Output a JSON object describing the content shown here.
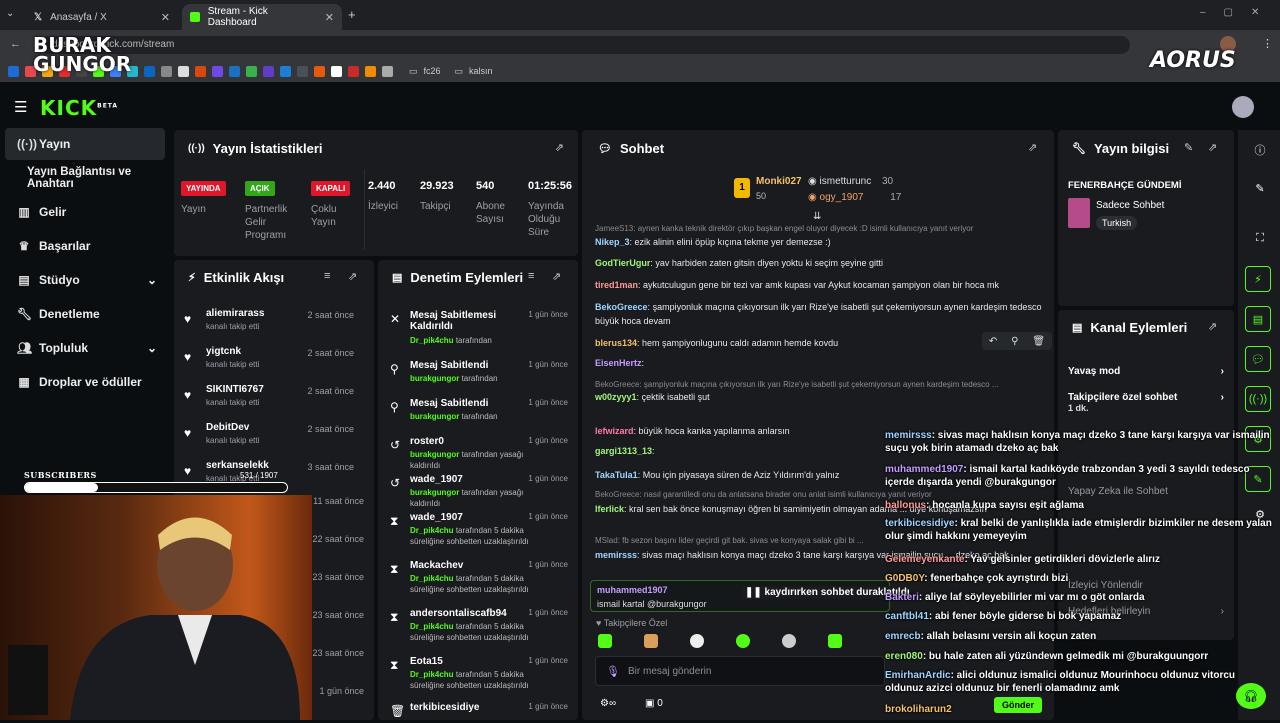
{
  "browser": {
    "tabs": [
      {
        "label": "Anasayfa / X"
      },
      {
        "label": "Stream - Kick Dashboard"
      }
    ],
    "url": "dashboard.kick.com/stream",
    "bookmarks": [
      "fc26",
      "kalsın"
    ]
  },
  "watermark": {
    "line1": "BURAK",
    "line2": "GUNGOR",
    "brand": "AORUS"
  },
  "kick": {
    "logo": "KICK",
    "beta": "BETA"
  },
  "sidebar": {
    "items": [
      {
        "label": "Yayın",
        "icon": "broadcast-icon"
      },
      {
        "label": "Yayın Bağlantısı ve Anahtarı",
        "icon": ""
      },
      {
        "label": "Gelir",
        "icon": "chart-icon"
      },
      {
        "label": "Başarılar",
        "icon": "trophy-icon"
      },
      {
        "label": "Stüdyo",
        "icon": "studio-icon"
      },
      {
        "label": "Denetleme",
        "icon": "wrench-icon"
      },
      {
        "label": "Topluluk",
        "icon": "people-icon"
      },
      {
        "label": "Droplar ve ödüller",
        "icon": "drops-icon"
      }
    ]
  },
  "stats": {
    "title": "Yayın İstatistikleri",
    "badges": [
      {
        "badge": "YAYINDA",
        "label": "Yayın",
        "color": "#e0162b"
      },
      {
        "badge": "AÇIK",
        "label": "Partnerlik Gelir Programı",
        "color": "#33a61b"
      },
      {
        "badge": "KAPALI",
        "label": "Çoklu Yayın",
        "color": "#e0162b"
      }
    ],
    "values": [
      {
        "value": "2.440",
        "label": "İzleyici"
      },
      {
        "value": "29.923",
        "label": "Takipçi"
      },
      {
        "value": "540",
        "label": "Abone Sayısı"
      },
      {
        "value": "01:25:56",
        "label": "Yayında Olduğu Süre"
      }
    ]
  },
  "activity": {
    "title": "Etkinlik Akışı",
    "items": [
      {
        "name": "aliemirarass",
        "sub": "kanalı takip etti",
        "time": "2 saat önce"
      },
      {
        "name": "yigtcnk",
        "sub": "kanalı takip etti",
        "time": "2 saat önce"
      },
      {
        "name": "SIKINTI6767",
        "sub": "kanalı takip etti",
        "time": "2 saat önce"
      },
      {
        "name": "DebitDev",
        "sub": "kanalı takip etti",
        "time": "2 saat önce"
      },
      {
        "name": "serkanselekk",
        "sub": "kanalı takip etti",
        "time": "3 saat önce"
      }
    ],
    "extra_times": [
      "11 saat önce",
      "22 saat önce",
      "23 saat önce",
      "23 saat önce",
      "23 saat önce",
      "1 gün önce"
    ]
  },
  "moderation": {
    "title": "Denetim Eylemleri",
    "items": [
      {
        "name": "Mesaj Sabitlemesi Kaldırıldı",
        "by": "Dr_pik4chu",
        "rest": "tarafından",
        "time": "1 gün önce",
        "icon": "pin-off-icon"
      },
      {
        "name": "Mesaj Sabitlendi",
        "by": "burakgungor",
        "rest": "tarafından",
        "time": "1 gün önce",
        "icon": "pin-icon"
      },
      {
        "name": "Mesaj Sabitlendi",
        "by": "burakgungor",
        "rest": "tarafından",
        "time": "1 gün önce",
        "icon": "pin-icon"
      },
      {
        "name": "roster0",
        "by": "burakgungor",
        "rest": "tarafından yasağı kaldırıldı",
        "time": "1 gün önce",
        "icon": "unban-icon"
      },
      {
        "name": "wade_1907",
        "by": "burakgungor",
        "rest": "tarafından yasağı kaldırıldı",
        "time": "1 gün önce",
        "icon": "unban-icon"
      },
      {
        "name": "wade_1907",
        "by": "Dr_pik4chu",
        "rest": "tarafından 5 dakika süreliğine sohbetten uzaklaştırıldı",
        "time": "1 gün önce",
        "icon": "timeout-icon"
      },
      {
        "name": "Mackachev",
        "by": "Dr_pik4chu",
        "rest": "tarafından 5 dakika süreliğine sohbetten uzaklaştırıldı",
        "time": "1 gün önce",
        "icon": "timeout-icon"
      },
      {
        "name": "andersontaliscafb94",
        "by": "Dr_pik4chu",
        "rest": "tarafından 5 dakika süreliğine sohbetten uzaklaştırıldı",
        "time": "1 gün önce",
        "icon": "timeout-icon"
      },
      {
        "name": "Eota15",
        "by": "Dr_pik4chu",
        "rest": "tarafından 5 dakika süreliğine sohbetten uzaklaştırıldı",
        "time": "1 gün önce",
        "icon": "timeout-icon"
      },
      {
        "name": "terkibicesidiye",
        "by": "",
        "rest": "",
        "time": "1 gün önce",
        "icon": "trash-icon"
      }
    ]
  },
  "chat": {
    "title": "Sohbet",
    "leaders": [
      {
        "name": "Monki027",
        "val": "50"
      },
      {
        "name": "ismetturunc",
        "val": "30"
      },
      {
        "name": "ogy_1907",
        "val": "17"
      }
    ],
    "messages": [
      {
        "user": "JameeS13",
        "text": "aynen kanka teknik direktör çıkıp başkan engel oluyor diyecek :D isimli kullanıcıya yanıt veriyor",
        "color": "#888",
        "reply": true
      },
      {
        "user": "Nikep_3",
        "text": "ezik alinin elini öpüp kıçına tekme yer demezse :)",
        "color": "#9fd6ff"
      },
      {
        "user": "GodTierUgur",
        "text": "yav harbiden zaten gitsin diyen yoktu ki seçim şeyine gitti",
        "color": "#a2f57a"
      },
      {
        "user": "tired1man",
        "text": "aykutculugun gene bir tezi var amk kupası var Aykut kocaman şampiyon olan bir hoca mk",
        "color": "#ff9a9a"
      },
      {
        "user": "BekoGreece",
        "text": "şampiyonluk maçına çıkıyorsun ilk yarı Rize'ye isabetli şut çekemiyorsun aynen kardeşim tedesco büyük hoca devam",
        "color": "#9fd6ff"
      },
      {
        "user": "blerus134",
        "text": "hem şampiyonlugunu caldı adamın hemde kovdu",
        "color": "#f3c26b"
      },
      {
        "user": "EisenHertz",
        "text": "",
        "color": "#c59dff"
      },
      {
        "user": "BekoGreece",
        "text": "şampiyonluk maçına çıkıyorsun ilk yarı Rize'ye isabetli şut çekemiyorsun aynen kardeşim tedesco ...",
        "color": "#888",
        "reply": true
      },
      {
        "user": "w00zyyy1",
        "text": "çektik isabetli şut",
        "color": "#a2f57a"
      },
      {
        "user": "lefwizard",
        "text": "büyük hoca kanka yapılanma anlarsın",
        "color": "#ff7aa8"
      },
      {
        "user": "gargi1313_13",
        "text": "",
        "color": "#a2f57a"
      },
      {
        "user": "TakaTula1",
        "text": "Mou için piyasaya süren de Aziz Yıldırım'dı yalnız",
        "color": "#9fd6ff"
      },
      {
        "user": "BekoGreece",
        "text": "nasıl garantiledi onu da anlatsana birader onu anlat isimli kullanıcıya yanıt veriyor",
        "color": "#888",
        "reply": true
      },
      {
        "user": "lferlick",
        "text": "kral sen bak önce konuşmayı öğren bi samimiyetin olmayan adama ... diye konuşamazsın",
        "color": "#a2f57a"
      },
      {
        "user": "MSlad",
        "text": "fb sezon başını lider geçirdi git bak. sivas ve konyaya salak gibi bi ...",
        "color": "#888",
        "reply": true
      },
      {
        "user": "memirsss",
        "text": "sivas maçı haklısın konya maçı dzeko 3 tane karşı karşıya var ismailin suçu ... dzeko aç bak",
        "color": "#9fd6ff"
      }
    ],
    "pinned": {
      "user": "muhammed1907",
      "text": "ismail kartal @burakgungor",
      "paused": "kaydırırken sohbet duraklatıldı"
    },
    "followers_only": "Takipçilere Özel",
    "placeholder": "Bir mesaj gönderin",
    "send": "Gönder",
    "counter": "0"
  },
  "info": {
    "title": "Yayın bilgisi",
    "stream_title": "FENERBAHÇE GÜNDEMİ",
    "category": "Sadece Sohbet",
    "lang": "Turkish"
  },
  "channel_actions": {
    "title": "Kanal Eylemleri",
    "items": [
      {
        "label": "Yavaş mod",
        "sub": ""
      },
      {
        "label": "Takipçilere özel sohbet",
        "sub": "1 dk."
      },
      {
        "label": "Yapay Zeka ile Sohbet",
        "sub": ""
      },
      {
        "label": "İzleyici Yönlendir",
        "sub": ""
      },
      {
        "label": "Hedefleri belirleyin",
        "sub": ""
      }
    ]
  },
  "overlay": {
    "subscribers_label": "SUBSCRIBERS",
    "subscribers_count": "531 / 1907",
    "subscribers_progress": 0.28,
    "chat": [
      {
        "user": "memirsss",
        "text": ": sivas maçı haklısın konya maçı dzeko 3 tane karşı karşıya var ismailin suçu yok birin atamadı dzeko aç bak",
        "color": "#9fd6ff"
      },
      {
        "user": "muhammed1907",
        "text": ": ismail kartal kadıköyde trabzondan 3 yedi 3 sayıldı tedesco içerde dışarda yendi @burakgungor",
        "color": "#c59dff"
      },
      {
        "user": "ballonus",
        "text": ": hocanla kupa sayısı eşit ağlama",
        "color": "#ff9a9a"
      },
      {
        "user": "terkibicesidiye",
        "text": ": kral belki de yanlışlıkla iade etmişlerdir bizimkiler ne desem yalan olur şimdi hakkını yemeyeyim",
        "color": "#9fd6ff"
      },
      {
        "user": "Gelemeyenkante",
        "text": ": Yav gelsinler getirdikleri dövizlerle alırız",
        "color": "#ff9a9a"
      },
      {
        "user": "G0DB0Y",
        "text": ": fenerbahçe çok ayrıştırdı bizi",
        "color": "#f3c26b"
      },
      {
        "user": "Bakteri",
        "text": ": aliye laf söyleyebilirler mi var mı o göt onlarda",
        "color": "#c59dff"
      },
      {
        "user": "canftbl41",
        "text": ": abi fener böyle giderse bi bok yapamaz",
        "color": "#9fd6ff"
      },
      {
        "user": "emrecb",
        "text": ": allah belasını versin ali koçun zaten",
        "color": "#9fd6ff"
      },
      {
        "user": "eren080",
        "text": ": bu hale zaten ali yüzündewn gelmedik mi @burakguungorr",
        "color": "#a2f57a"
      },
      {
        "user": "EmirhanArdic",
        "text": ": alici oldunuz ismalici oldunuz Mourinhocu oldunuz vitorcu oldunuz azizci oldunuz bir fenerli olamadınız amk",
        "color": "#9fd6ff"
      },
      {
        "user": "brokoliharun2",
        "text": "",
        "color": "#f3c26b"
      }
    ]
  }
}
